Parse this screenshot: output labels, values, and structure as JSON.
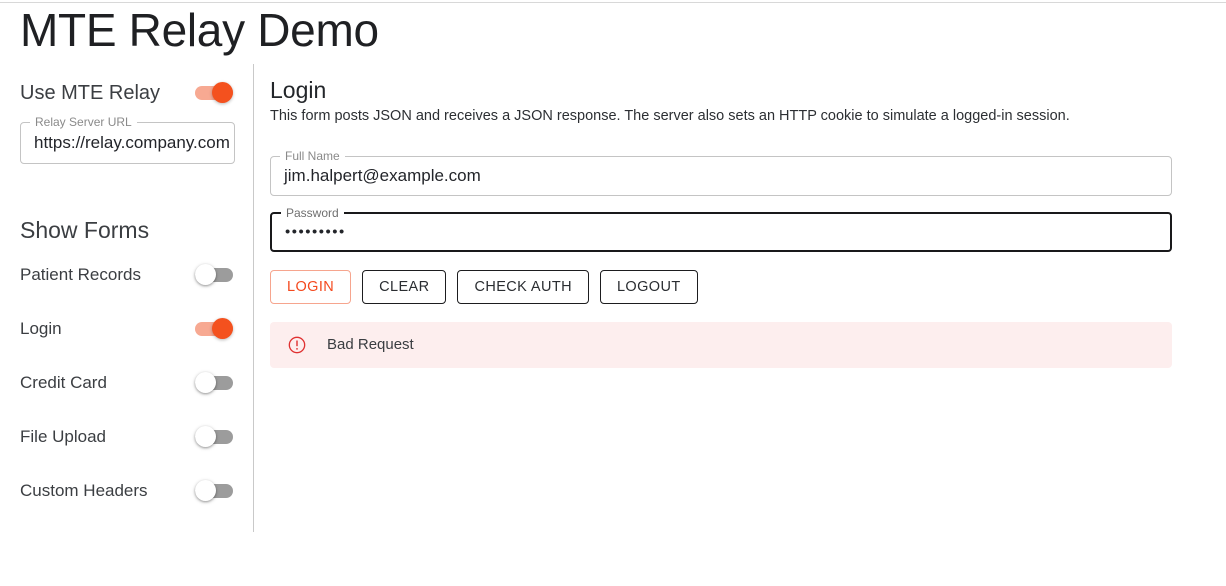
{
  "app": {
    "title": "MTE Relay Demo"
  },
  "sidebar": {
    "relay_toggle": {
      "label": "Use MTE Relay",
      "state": "on",
      "icon": "toggle-switch-icon"
    },
    "relay_url_field": {
      "legend": "Relay Server URL",
      "value": "https://relay.company.com",
      "placeholder": "Relay Server URL"
    },
    "show_forms_heading": "Show Forms",
    "form_toggles": [
      {
        "label": "Patient Records",
        "state": "off"
      },
      {
        "label": "Login",
        "state": "on"
      },
      {
        "label": "Credit Card",
        "state": "off"
      },
      {
        "label": "File Upload",
        "state": "off"
      },
      {
        "label": "Custom Headers",
        "state": "off"
      }
    ]
  },
  "main": {
    "section_title": "Login",
    "section_description": "This form posts JSON and receives a JSON response. The server also sets an HTTP cookie to simulate a logged-in session.",
    "fields": [
      {
        "legend": "Full Name",
        "value": "jim.halpert@example.com",
        "placeholder": "Full Name",
        "focused": false
      },
      {
        "legend": "Password",
        "value": "•••••••••",
        "placeholder": "Password",
        "focused": true
      }
    ],
    "buttons": [
      {
        "label": "LOGIN",
        "style": "accent"
      },
      {
        "label": "CLEAR",
        "style": "default"
      },
      {
        "label": "CHECK AUTH",
        "style": "default"
      },
      {
        "label": "LOGOUT",
        "style": "default"
      }
    ],
    "alert": {
      "icon": "error-circle-icon",
      "text": "Bad Request",
      "background": "#fdeeee",
      "icon_color": "#e03131"
    }
  },
  "colors": {
    "accent": "#f4511e",
    "accent_text": "#f4491e",
    "accent_track": "#f7a992",
    "toggle_off_track": "#9c9c9c",
    "text_primary": "#3b3e42",
    "title": "#1f2023",
    "field_border": "#c4c4c4",
    "field_border_focused": "#19191b",
    "divider": "#c9c9c9"
  }
}
